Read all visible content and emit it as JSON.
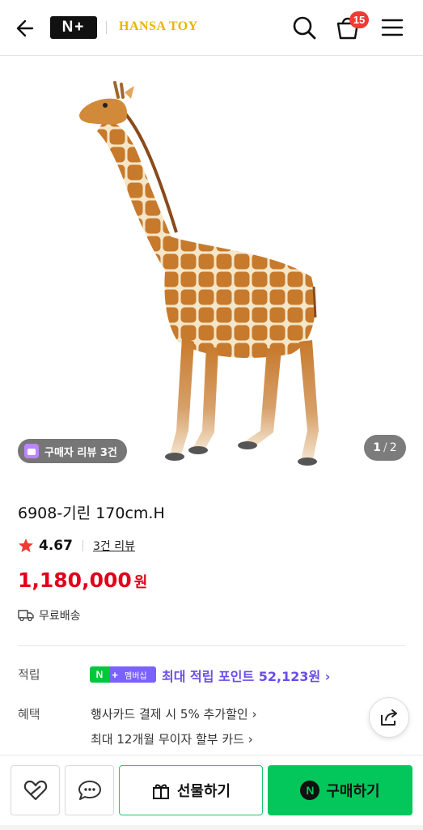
{
  "header": {
    "logo_text": "N+",
    "brand": "HANSA TOY",
    "cart_count": "15",
    "icons": [
      "back-arrow-icon",
      "search-icon",
      "cart-icon",
      "menu-icon"
    ]
  },
  "gallery": {
    "review_pill": "구매자 리뷰 3건",
    "page_current": "1",
    "page_total": "2"
  },
  "product": {
    "title": "6908-기린 170cm.H",
    "rating": "4.67",
    "review_link": "3건 리뷰",
    "price": "1,180,000",
    "currency": "원",
    "shipping": "무료배송"
  },
  "points": {
    "label": "적립",
    "badge_n": "N",
    "badge_plus": "+",
    "badge_member": "멤버십",
    "text": "최대 적립 포인트 52,123원 ›"
  },
  "benefits": {
    "label": "혜택",
    "items": [
      "행사카드 결제 시 5% 추가할인 ›",
      "최대 12개월 무이자 할부 카드 ›"
    ]
  },
  "bottom_bar": {
    "gift_label": "선물하기",
    "buy_n": "N",
    "buy_label": "구매하기"
  },
  "colors": {
    "price_red": "#e2001a",
    "naver_green": "#03c75a",
    "points_purple": "#6b4ee6",
    "brand_gold": "#e8b400",
    "badge_red": "#f03a33"
  }
}
